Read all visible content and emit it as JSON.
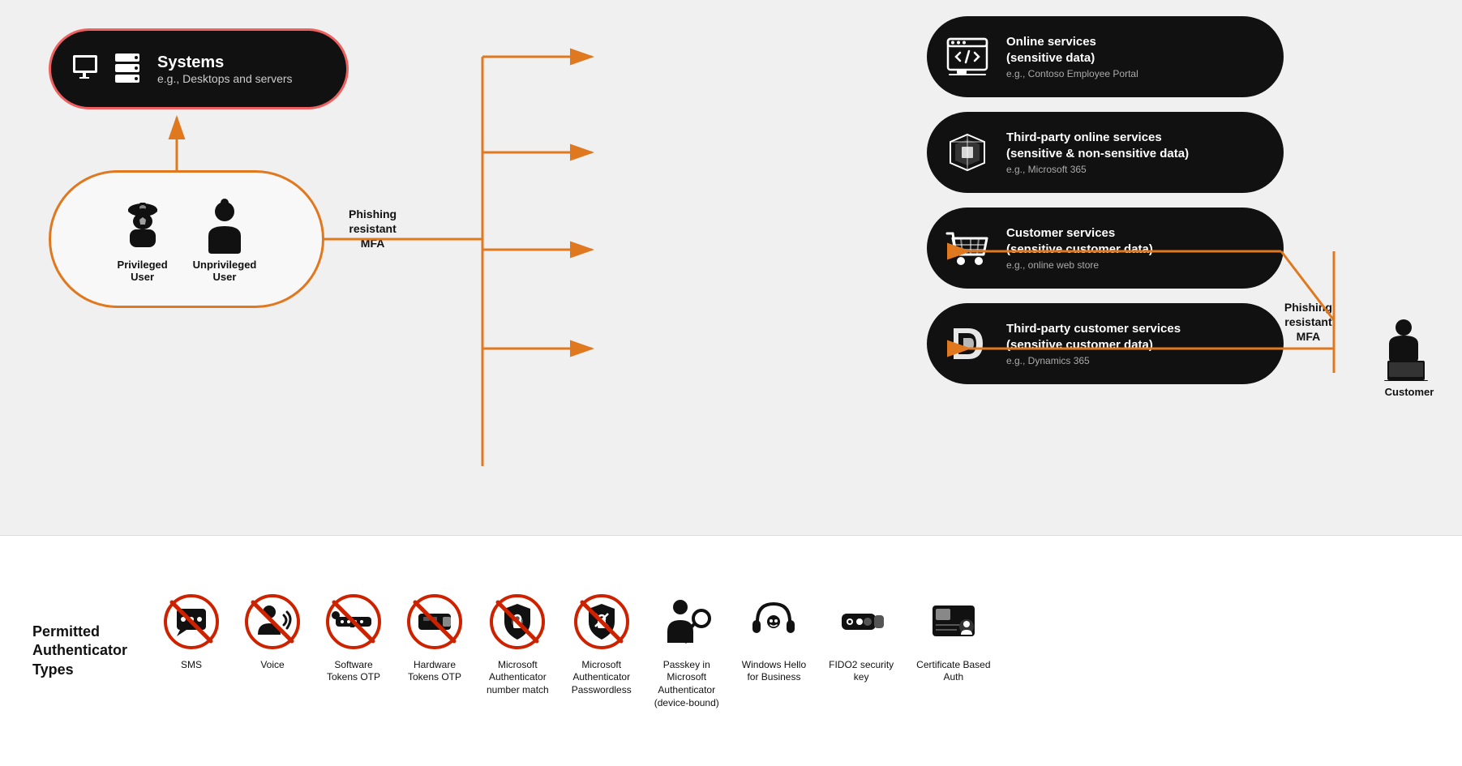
{
  "systems": {
    "title": "Systems",
    "subtitle": "e.g., Desktops and servers"
  },
  "users": {
    "privileged_label": "Privileged\nUser",
    "unprivileged_label": "Unprivileged\nUser"
  },
  "phishing_left": "Phishing\nresistant\nMFA",
  "phishing_right": "Phishing\nresistant\nMFA",
  "services": [
    {
      "title": "Online services\n(sensitive data)",
      "subtitle": "e.g., Contoso Employee Portal"
    },
    {
      "title": "Third-party online services\n(sensitive & non-sensitive data)",
      "subtitle": "e.g., Microsoft 365"
    },
    {
      "title": "Customer services\n(sensitive customer data)",
      "subtitle": "e.g., online web store"
    },
    {
      "title": "Third-party customer services\n(sensitive customer data)",
      "subtitle": "e.g., Dynamics 365"
    }
  ],
  "customer_label": "Customer",
  "permitted": {
    "heading": "Permitted\nAuthenticator\nTypes"
  },
  "authenticators": [
    {
      "label": "SMS",
      "allowed": false,
      "type": "sms"
    },
    {
      "label": "Voice",
      "allowed": false,
      "type": "voice"
    },
    {
      "label": "Software\nTokens OTP",
      "allowed": false,
      "type": "software-tokens"
    },
    {
      "label": "Hardware\nTokens OTP",
      "allowed": false,
      "type": "hardware-tokens"
    },
    {
      "label": "Microsoft\nAuthenticator\nnumber match",
      "allowed": false,
      "type": "ms-auth-number"
    },
    {
      "label": "Microsoft\nAuthenticator\nPasswordless",
      "allowed": false,
      "type": "ms-auth-passwordless"
    },
    {
      "label": "Passkey in\nMicrosoft\nAuthenticator\n(device-bound)",
      "allowed": true,
      "type": "passkey"
    },
    {
      "label": "Windows Hello\nfor Business",
      "allowed": true,
      "type": "windows-hello"
    },
    {
      "label": "FIDO2 security\nkey",
      "allowed": true,
      "type": "fido2"
    },
    {
      "label": "Certificate Based\nAuth",
      "allowed": true,
      "type": "cert-based"
    }
  ]
}
